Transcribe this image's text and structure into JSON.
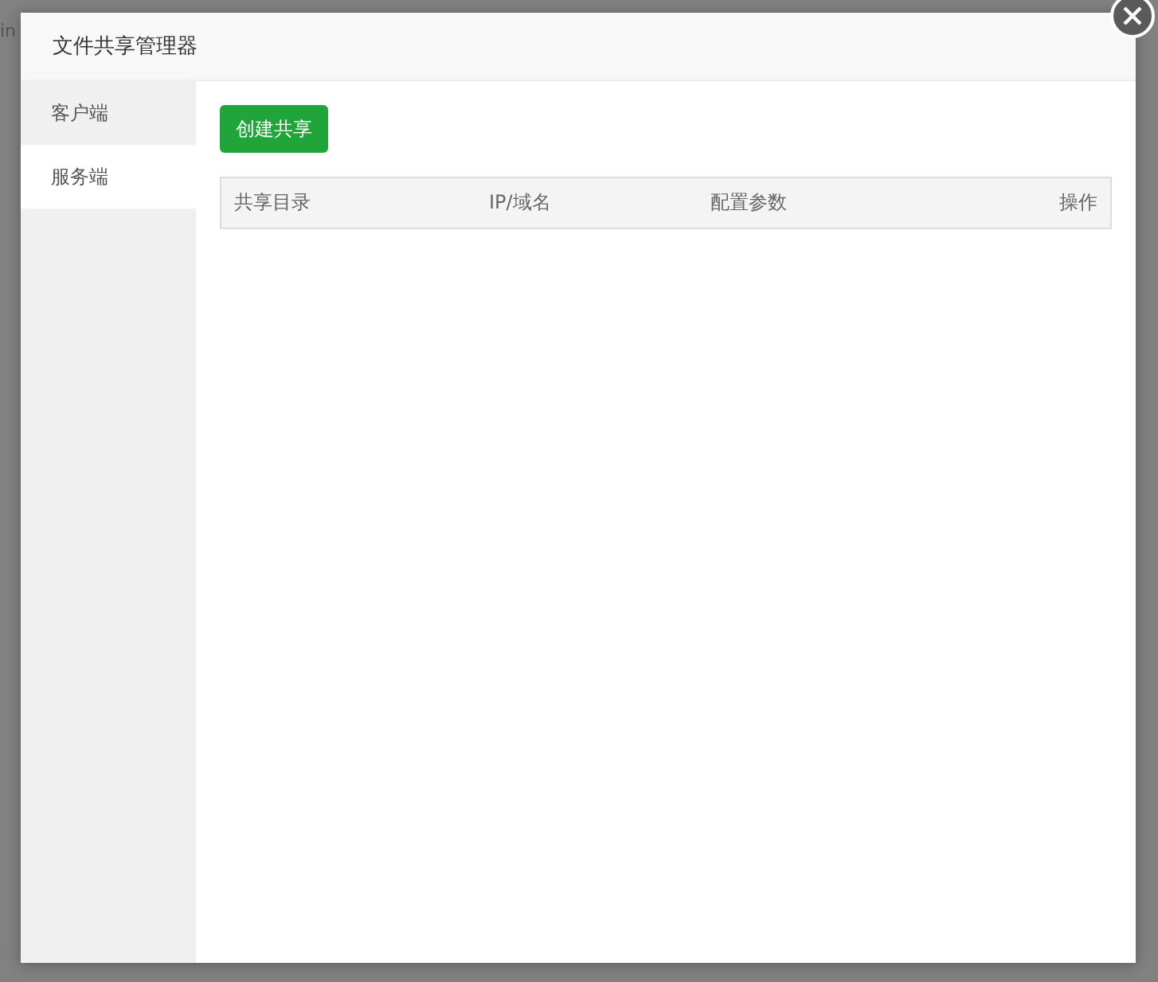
{
  "background_text": "in",
  "dialog": {
    "title": "文件共享管理器"
  },
  "sidebar": {
    "items": [
      {
        "label": "客户端",
        "selected": false
      },
      {
        "label": "服务端",
        "selected": true
      }
    ]
  },
  "create_button": "创建共享",
  "table": {
    "columns": [
      "共享目录",
      "IP/域名",
      "配置参数",
      "操作"
    ]
  }
}
